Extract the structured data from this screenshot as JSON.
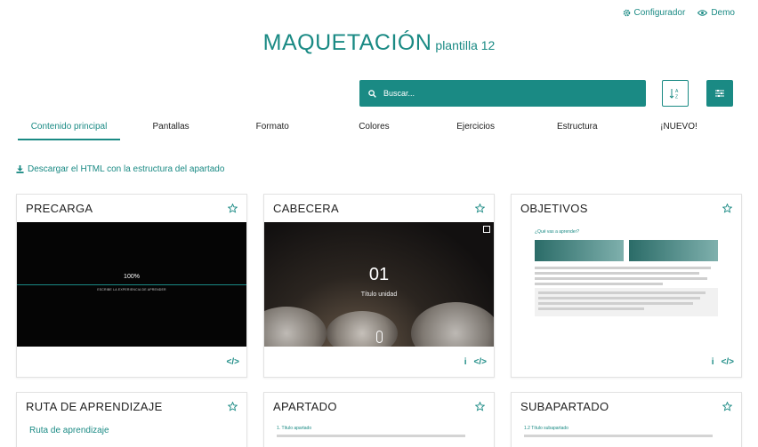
{
  "topbar": {
    "configurador": "Configurador",
    "demo": "Demo"
  },
  "header": {
    "title": "MAQUETACIÓN",
    "subtitle": "plantilla 12"
  },
  "search": {
    "placeholder": "Buscar..."
  },
  "tabs": [
    "Contenido principal",
    "Pantallas",
    "Formato",
    "Colores",
    "Ejercicios",
    "Estructura",
    "¡NUEVO!"
  ],
  "download": {
    "label": "Descargar el HTML con la estructura del apartado"
  },
  "cards": [
    {
      "title": "PRECARGA",
      "preview": {
        "percent": "100%",
        "caption": "ESCRIBE LA EXPERIENCIA DE APRENDER"
      }
    },
    {
      "title": "CABECERA",
      "preview": {
        "number": "01",
        "subtitle": "Título unidad"
      }
    },
    {
      "title": "OBJETIVOS",
      "preview": {
        "question": "¿Qué vas a aprender?"
      }
    },
    {
      "title": "RUTA DE APRENDIZAJE",
      "preview": {
        "heading": "Ruta de aprendizaje"
      }
    },
    {
      "title": "APARTADO",
      "preview": {
        "heading": "1. Título apartado"
      }
    },
    {
      "title": "SUBAPARTADO",
      "preview": {
        "heading": "1.2 Título subapartado"
      }
    }
  ],
  "colors": {
    "accent": "#1a8a84"
  },
  "icons": [
    "gear-icon",
    "eye-icon",
    "search-icon",
    "sort-alpha-icon",
    "sliders-icon",
    "download-icon",
    "star-icon",
    "info-icon",
    "code-icon"
  ]
}
